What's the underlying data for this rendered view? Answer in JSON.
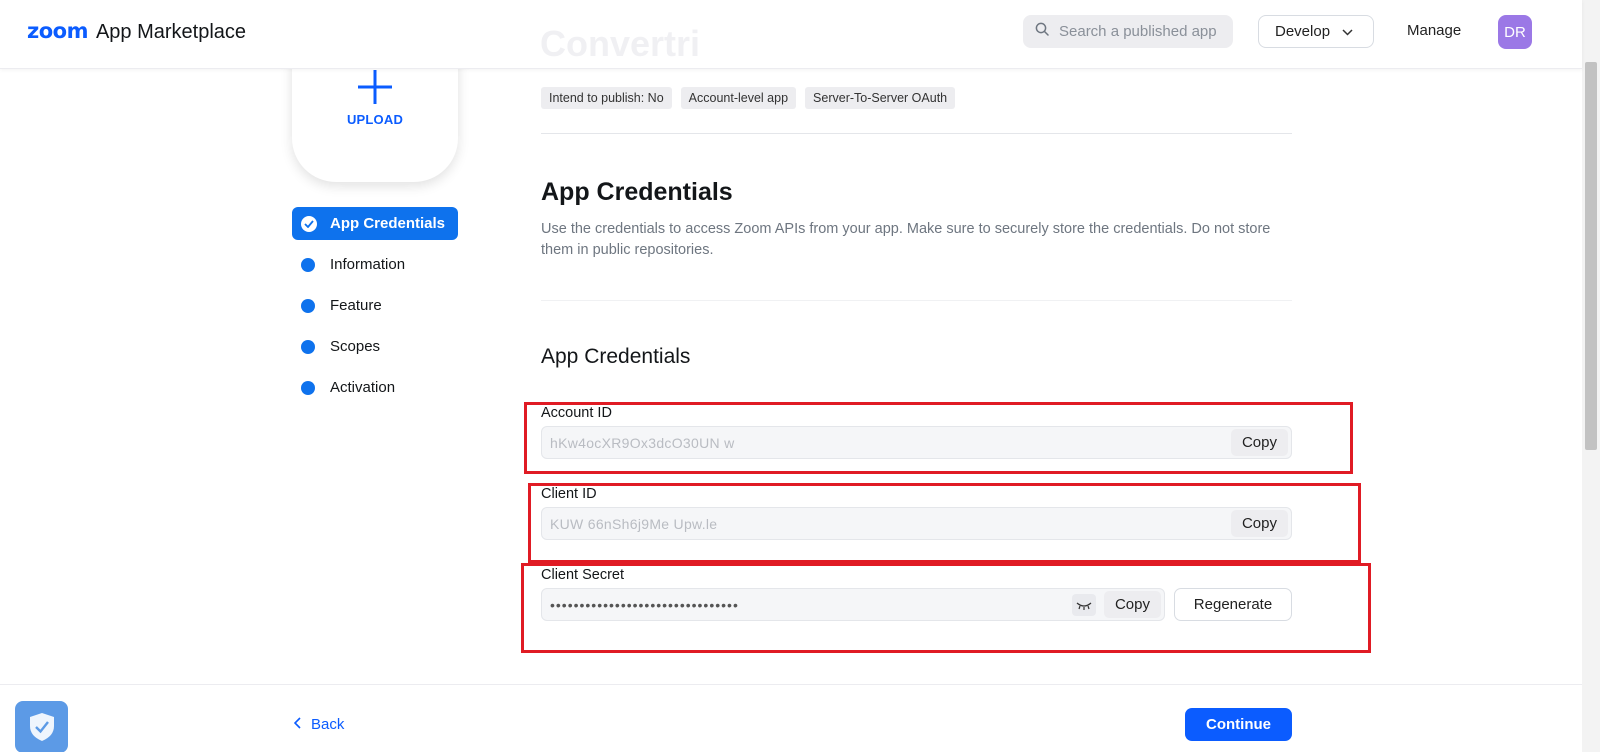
{
  "header": {
    "logo_brand": "zoom",
    "logo_text": "App Marketplace",
    "search_placeholder": "Search a published app",
    "develop_label": "Develop",
    "manage_label": "Manage",
    "avatar_initials": "DR",
    "avatar_color": "#9b78e6"
  },
  "app": {
    "title": "Convertri",
    "badges": [
      "Intend to publish: No",
      "Account-level app",
      "Server-To-Server OAuth"
    ]
  },
  "upload": {
    "label": "UPLOAD"
  },
  "nav": {
    "items": [
      {
        "label": "App Credentials",
        "active": true
      },
      {
        "label": "Information",
        "active": false
      },
      {
        "label": "Feature",
        "active": false
      },
      {
        "label": "Scopes",
        "active": false
      },
      {
        "label": "Activation",
        "active": false
      }
    ]
  },
  "main": {
    "section_title": "App Credentials",
    "section_description": "Use the credentials to access Zoom APIs from your app. Make sure to securely store the credentials. Do not store them in public repositories.",
    "subsection_title": "App Credentials",
    "account_id": {
      "label": "Account ID",
      "value": "hKw4ocXR9Ox3dcO30UN w",
      "copy_label": "Copy"
    },
    "client_id": {
      "label": "Client ID",
      "value": "KUW 66nSh6j9Me  Upw.le",
      "copy_label": "Copy"
    },
    "client_secret": {
      "label": "Client Secret",
      "value": "••••••••••••••••••••••••••••••••",
      "copy_label": "Copy",
      "regenerate_label": "Regenerate"
    }
  },
  "footer": {
    "back_label": "Back",
    "continue_label": "Continue"
  },
  "colors": {
    "brand": "#0b5cff",
    "nav_active": "#0e72ed",
    "highlight": "#e01b24"
  }
}
